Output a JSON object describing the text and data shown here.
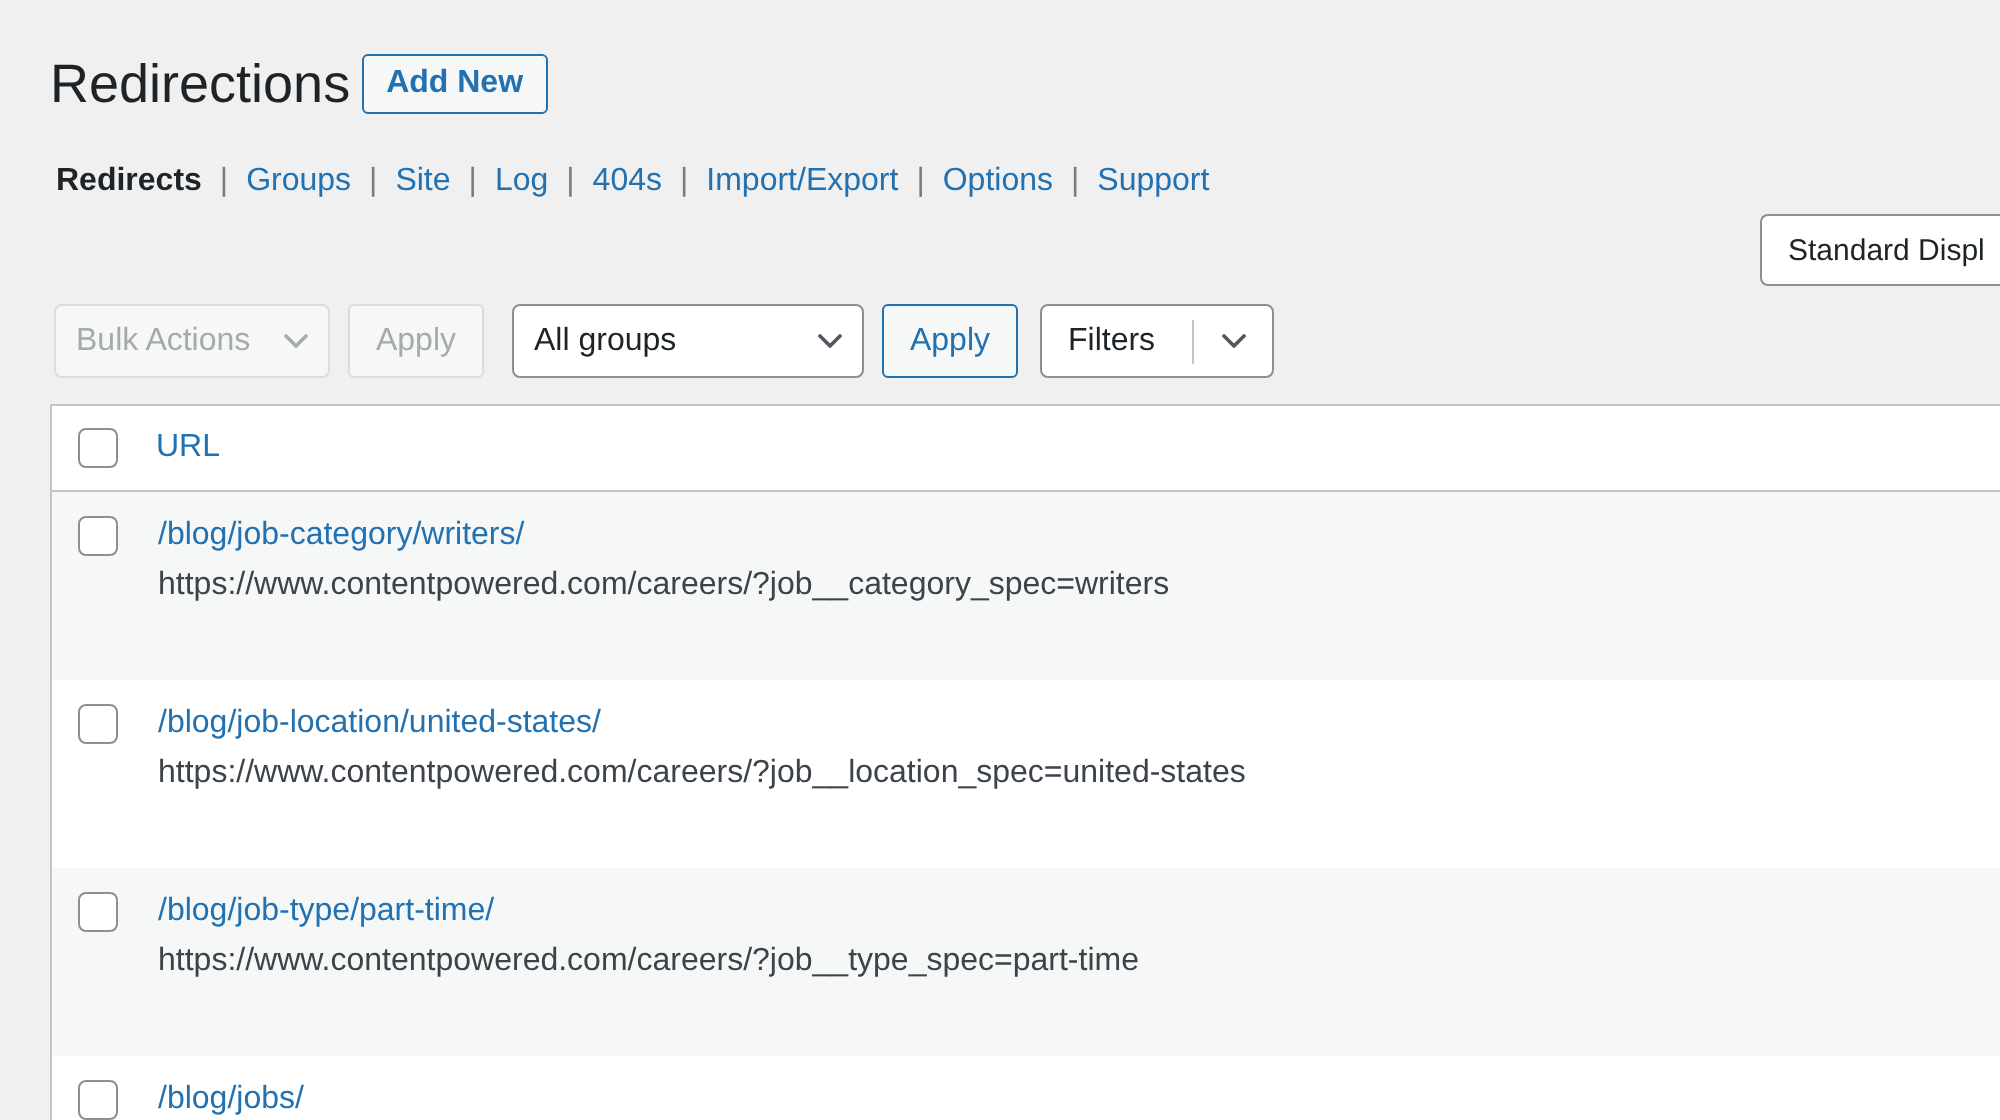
{
  "page": {
    "title": "Redirections",
    "add_new_button": "Add New"
  },
  "subnav": {
    "separator": "|",
    "items": [
      {
        "label": "Redirects",
        "selected": true
      },
      {
        "label": "Groups",
        "selected": false
      },
      {
        "label": "Site",
        "selected": false
      },
      {
        "label": "Log",
        "selected": false
      },
      {
        "label": "404s",
        "selected": false
      },
      {
        "label": "Import/Export",
        "selected": false
      },
      {
        "label": "Options",
        "selected": false
      },
      {
        "label": "Support",
        "selected": false
      }
    ]
  },
  "display_select": {
    "value": "Standard Displ"
  },
  "toolbar": {
    "bulk_actions": {
      "value": "Bulk Actions",
      "disabled": true
    },
    "apply_bulk": {
      "label": "Apply",
      "disabled": true
    },
    "group_select": {
      "value": "All groups"
    },
    "apply_group": {
      "label": "Apply",
      "disabled": false
    },
    "filters": {
      "label": "Filters"
    }
  },
  "table": {
    "header": {
      "checked": false,
      "column": "URL"
    },
    "rows": [
      {
        "checked": false,
        "source": "/blog/job-category/writers/",
        "target": "https://www.contentpowered.com/careers/?job__category_spec=writers"
      },
      {
        "checked": false,
        "source": "/blog/job-location/united-states/",
        "target": "https://www.contentpowered.com/careers/?job__location_spec=united-states"
      },
      {
        "checked": false,
        "source": "/blog/job-type/part-time/",
        "target": "https://www.contentpowered.com/careers/?job__type_spec=part-time"
      },
      {
        "checked": false,
        "source": "/blog/jobs/"
      }
    ]
  }
}
